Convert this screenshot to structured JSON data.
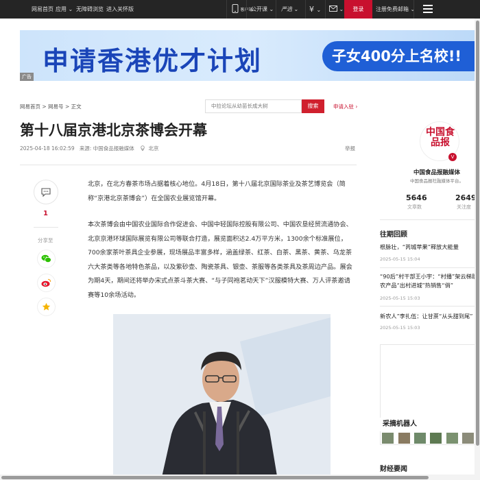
{
  "topbar": {
    "nav": [
      "网易首页",
      "应用",
      "无障碍浏览",
      "进入关怀版"
    ],
    "app_label": "客户端",
    "public_class": "公开课",
    "yanxuan": "严选",
    "pay_icon": "yen-icon",
    "mail_icon": "mail-icon",
    "login": "登录",
    "register_mail": "注册免费邮箱"
  },
  "banner": {
    "title": "申请香港优才计划",
    "pill": "子女400分上名校!!",
    "ad_tag": "广告"
  },
  "breadcrumb": [
    "网易首页",
    "网易号",
    "正文"
  ],
  "search": {
    "placeholder": "中拉论坛从幼苗长成大树",
    "button": "搜索",
    "submit_link": "申请入驻"
  },
  "article": {
    "title": "第十八届京港北京茶博会开幕",
    "datetime": "2025-04-18 16:02:59",
    "source": "来源: 中国食品报融媒体",
    "location": "北京",
    "report": "举报",
    "para1": "北京，在北方春茶市场占据着核心地位。4月18日，第十八届北京国际茶业及茶艺博览会（简称“京港北京茶博会”）在全国农业展览馆开幕。",
    "para2": "本次茶博会由中国农业国际合作促进会、中国中轻国际控股有限公司、中国农垦经贸流通协会、北京京港环球国际展览有限公司等联合打造，展览面积达2.4万平方米，1300余个标准展位，700余家茶叶茶具企业参展，现场展品丰富多样，涵盖绿茶、红茶、白茶、黑茶、黄茶、乌龙茶六大茶类等各地特色茶品，以及紫砂壶、陶瓷茶具、银壶、茶服等各类茶具及茶周边产品。展会为期4天，期间还将举办宋式点茶斗茶大赛、“与子同袍茗动天下”汉服模特大赛、万人评茶邀请赛等10余场活动。"
  },
  "share": {
    "comment_count": "1",
    "label": "分享至"
  },
  "sidebar": {
    "logo_text": "中国食品报",
    "name": "中国食品报融媒体",
    "desc": "中国食品报社融媒体平台。",
    "stats": [
      {
        "num": "5646",
        "label": "文章数"
      },
      {
        "num": "2649",
        "label": "关注度"
      }
    ],
    "past_heading": "往期回顾",
    "past": [
      {
        "title": "根脉壮，“芮城苹果”释放大能量",
        "time": "2025-05-15 15:04"
      },
      {
        "title": "“90后”村干部王小宇：“村播”架云梯助农产品“出村进城”热销售“俏”",
        "time": "2025-05-15 15:03"
      },
      {
        "title": "新农人”李扎伍：让甘蔗“从头甜到尾”",
        "time": "2025-05-15 15:03"
      }
    ],
    "robot_label": "采摘机器人",
    "finance_heading": "财经要闻"
  },
  "colors": {
    "accent": "#c8102e",
    "topbar": "#252525",
    "banner_text": "#1a45b8"
  }
}
